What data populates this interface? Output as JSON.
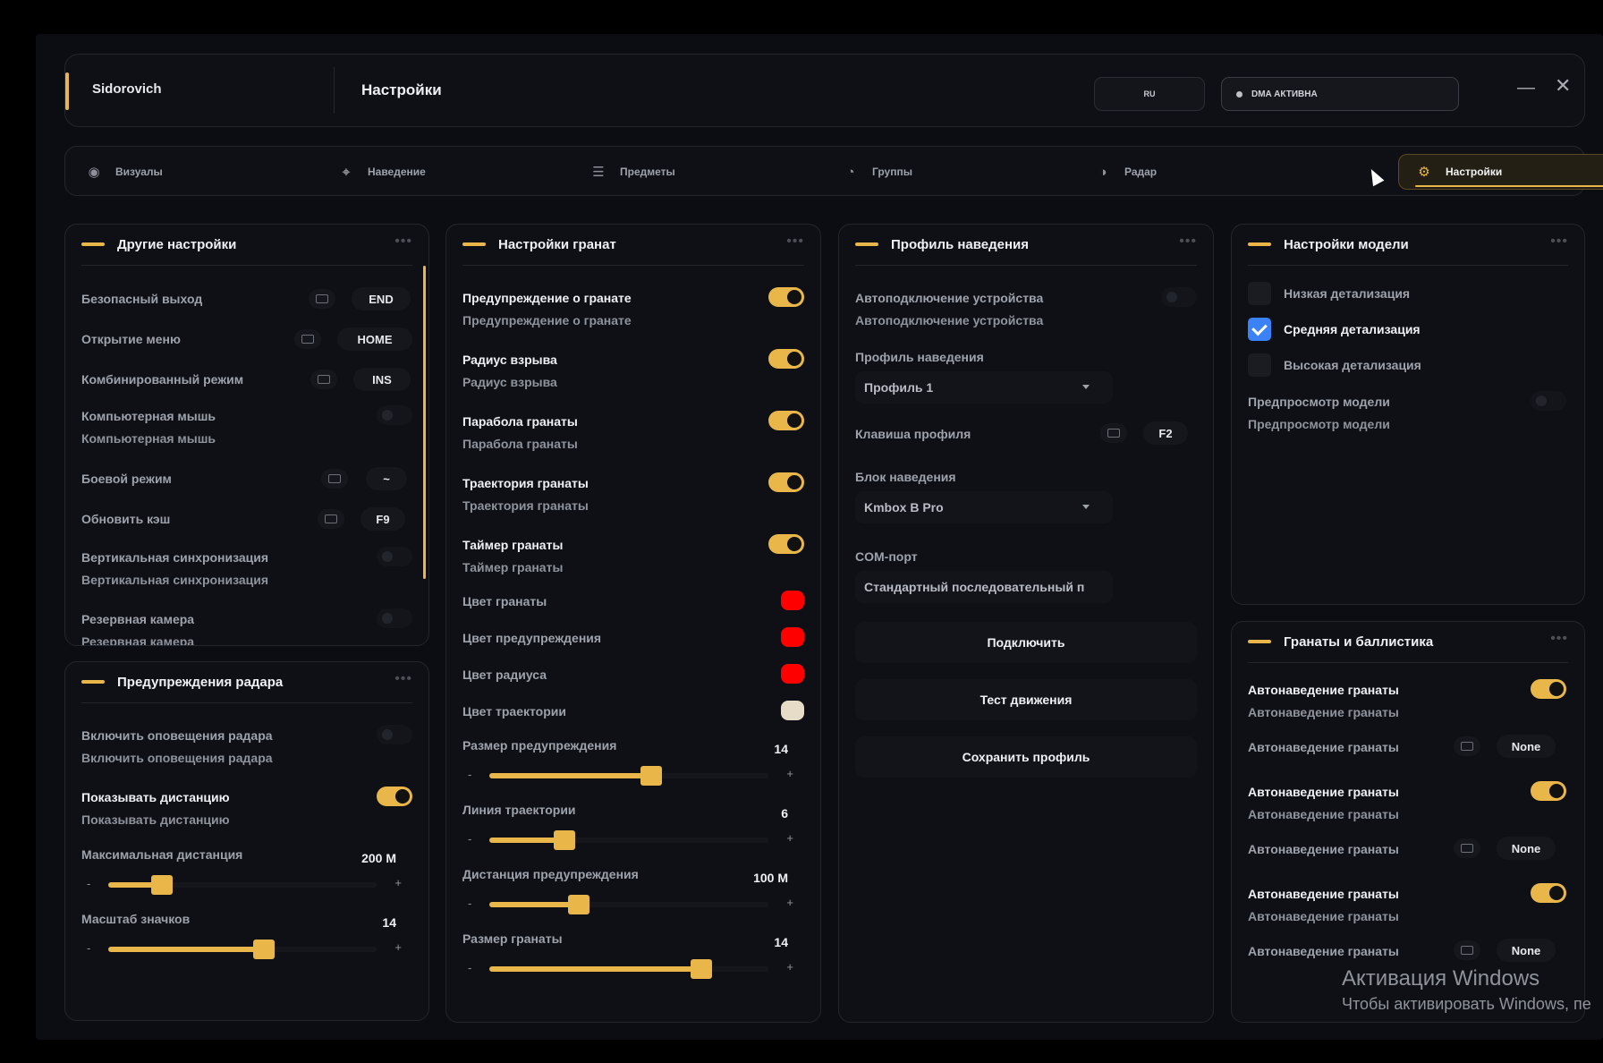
{
  "header": {
    "brand": "Sidorovich",
    "title": "Настройки",
    "lang": "RU",
    "dma_status": "DMA АКТИВНА"
  },
  "tabs": [
    {
      "label": "Визуалы",
      "icon": "eye-icon"
    },
    {
      "label": "Наведение",
      "icon": "crosshair-icon"
    },
    {
      "label": "Предметы",
      "icon": "sliders-icon"
    },
    {
      "label": "Группы",
      "icon": "gauge-icon"
    },
    {
      "label": "Радар",
      "icon": "radar-icon"
    },
    {
      "label": "Настройки",
      "icon": "gear-icon",
      "active": true
    }
  ],
  "other_settings": {
    "title": "Другие настройки",
    "safe_exit": {
      "label": "Безопасный выход",
      "key": "END"
    },
    "open_menu": {
      "label": "Открытие меню",
      "key": "HOME"
    },
    "combined_mode": {
      "label": "Комбинированный режим",
      "key": "INS"
    },
    "computer_mouse": {
      "label": "Компьютерная мышь",
      "sub": "Компьютерная мышь",
      "enabled": false
    },
    "combat_mode": {
      "label": "Боевой режим",
      "key": "~"
    },
    "refresh_cache": {
      "label": "Обновить кэш",
      "key": "F9"
    },
    "vsync": {
      "label": "Вертикальная синхронизация",
      "sub": "Вертикальная синхронизация",
      "enabled": false
    },
    "backup_camera": {
      "label": "Резервная камера",
      "sub": "Резервная камера",
      "enabled": false
    }
  },
  "radar_warnings": {
    "title": "Предупреждения радара",
    "enable_alerts": {
      "label": "Включить оповещения радара",
      "sub": "Включить оповещения радара",
      "enabled": false
    },
    "show_distance": {
      "label": "Показывать дистанцию",
      "sub": "Показывать дистанцию",
      "enabled": true
    },
    "max_distance": {
      "label": "Максимальная дистанция",
      "value": "200 М",
      "fraction": 0.2
    },
    "icon_scale": {
      "label": "Масштаб значков",
      "value": "14",
      "fraction": 0.58
    }
  },
  "grenade_settings": {
    "title": "Настройки гранат",
    "toggles": [
      {
        "label": "Предупреждение о гранате",
        "sub": "Предупреждение о гранате",
        "enabled": true
      },
      {
        "label": "Радиус взрыва",
        "sub": "Радиус взрыва",
        "enabled": true
      },
      {
        "label": "Парабола гранаты",
        "sub": "Парабола гранаты",
        "enabled": true
      },
      {
        "label": "Траектория гранаты",
        "sub": "Траектория гранаты",
        "enabled": true
      },
      {
        "label": "Таймер гранаты",
        "sub": "Таймер гранаты",
        "enabled": true
      }
    ],
    "colors": [
      {
        "label": "Цвет гранаты",
        "color": "#ff0000"
      },
      {
        "label": "Цвет предупреждения",
        "color": "#ff0000"
      },
      {
        "label": "Цвет радиуса",
        "color": "#ff0000"
      },
      {
        "label": "Цвет траектории",
        "color": "#e6dcc8"
      }
    ],
    "sliders": [
      {
        "label": "Размер предупреждения",
        "value": "14",
        "fraction": 0.58
      },
      {
        "label": "Линия траектории",
        "value": "6",
        "fraction": 0.27
      },
      {
        "label": "Дистанция предупреждения",
        "value": "100 М",
        "fraction": 0.32
      },
      {
        "label": "Размер гранаты",
        "value": "14",
        "fraction": 0.76
      }
    ]
  },
  "aim_profile": {
    "title": "Профиль наведения",
    "auto_connect": {
      "label": "Автоподключение устройства",
      "sub": "Автоподключение устройства",
      "enabled": false
    },
    "profile_label": "Профиль наведения",
    "profile_value": "Профиль 1",
    "profile_key": {
      "label": "Клавиша профиля",
      "key": "F2"
    },
    "block_label": "Блок наведения",
    "block_value": "Kmbox B Pro",
    "com_label": "COM-порт",
    "com_value": "Стандартный последовательный п",
    "connect_btn": "Подключить",
    "test_btn": "Тест движения",
    "save_btn": "Сохранить профиль"
  },
  "model_settings": {
    "title": "Настройки модели",
    "options": [
      {
        "label": "Низкая детализация",
        "checked": false
      },
      {
        "label": "Средняя детализация",
        "checked": true
      },
      {
        "label": "Высокая детализация",
        "checked": false
      }
    ],
    "preview": {
      "label": "Предпросмотр модели",
      "sub": "Предпросмотр модели",
      "enabled": false
    }
  },
  "ballistics": {
    "title": "Гранаты и баллистика",
    "groups": [
      {
        "label": "Автонаведение гранаты",
        "sub": "Автонаведение гранаты",
        "enabled": true,
        "key_label": "Автонаведение гранаты",
        "key": "None"
      },
      {
        "label": "Автонаведение гранаты",
        "sub": "Автонаведение гранаты",
        "enabled": true,
        "key_label": "Автонаведение гранаты",
        "key": "None"
      },
      {
        "label": "Автонаведение гранаты",
        "sub": "Автонаведение гранаты",
        "enabled": true,
        "key_label": "Автонаведение гранаты",
        "key": "None"
      }
    ]
  },
  "watermark": {
    "line1": "Активация Windows",
    "line2": "Чтобы активировать Windows, пе"
  }
}
